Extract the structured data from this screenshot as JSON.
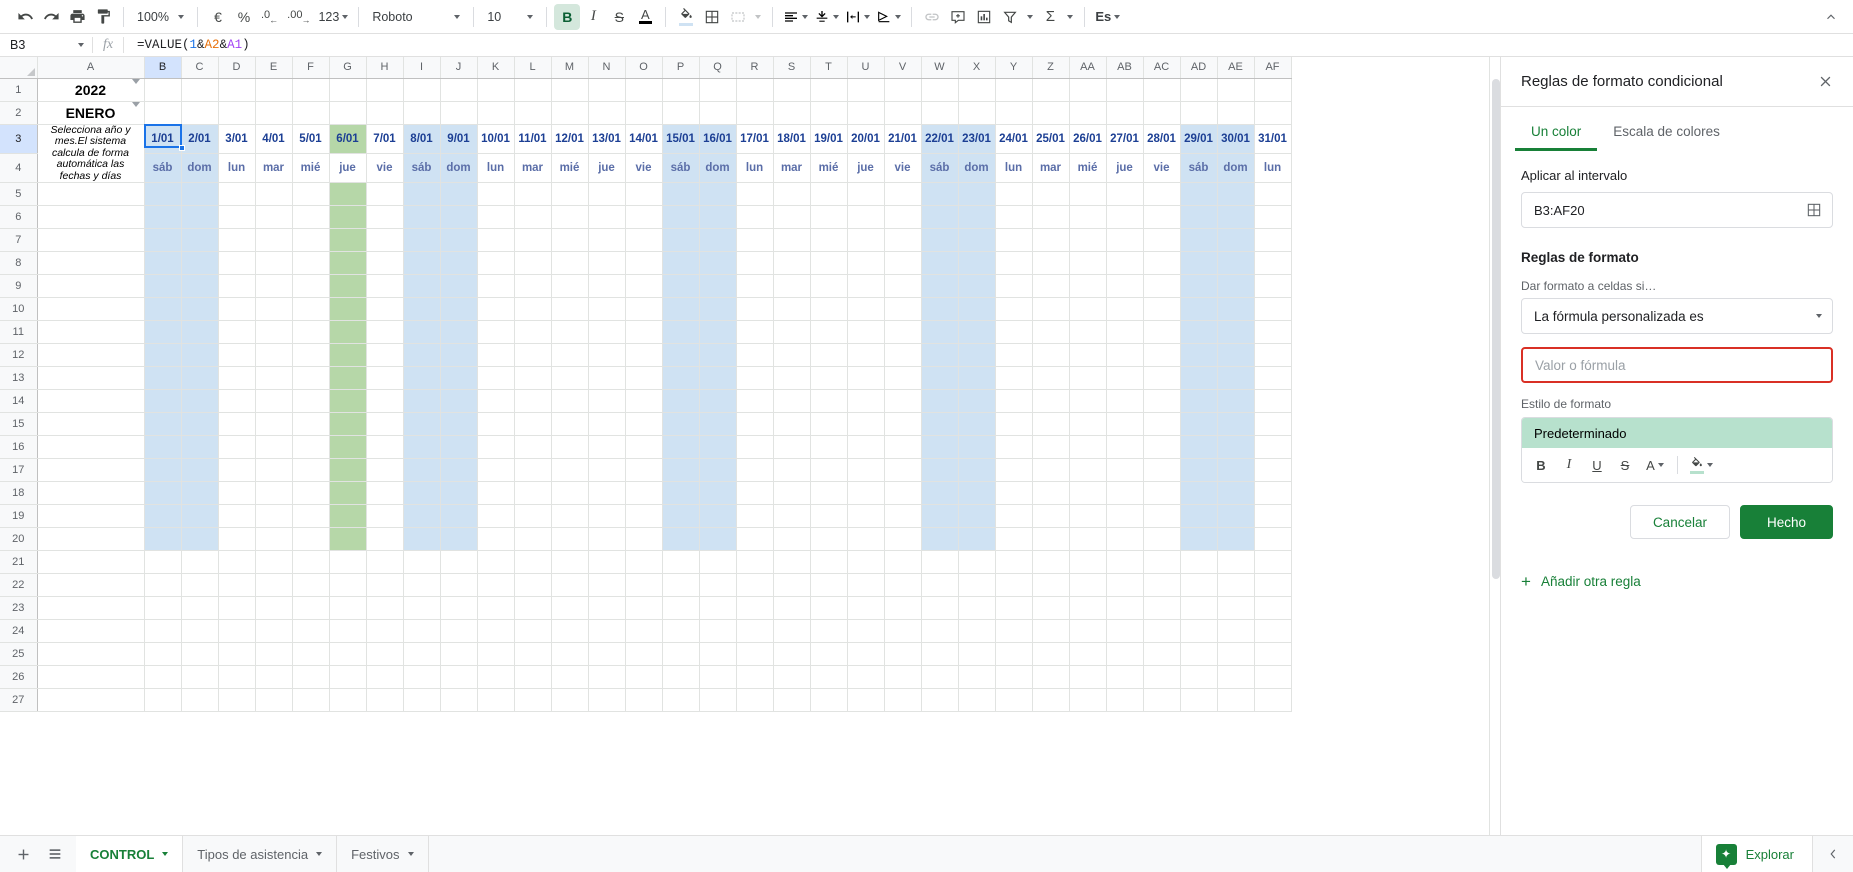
{
  "toolbar": {
    "undo_icon": "undo-icon",
    "redo_icon": "redo-icon",
    "print_icon": "print-icon",
    "paint_format_icon": "paint-format-icon",
    "zoom_value": "100%",
    "currency_label": "€",
    "percent_label": "%",
    "dec_decrease_label": ".0",
    "dec_increase_label": ".00",
    "number_format_label": "123",
    "font_family": "Roboto",
    "font_size": "10",
    "bold_label": "B",
    "italic_label": "I",
    "strikethrough_label": "S",
    "text_color_label": "A",
    "fill_color_icon": "fill-color-icon",
    "borders_icon": "borders-icon",
    "merge_icon": "merge-cells-icon",
    "halign_icon": "horizontal-align-icon",
    "valign_icon": "vertical-align-icon",
    "wrap_icon": "text-wrapping-icon",
    "rotate_icon": "text-rotation-icon",
    "link_icon": "insert-link-icon",
    "comment_icon": "insert-comment-icon",
    "chart_icon": "insert-chart-icon",
    "filter_icon": "filter-icon",
    "functions_label": "Σ",
    "lang_label": "Es",
    "collapse_label": "⌃"
  },
  "formula_bar": {
    "name_box": "B3",
    "fx_label": "fx",
    "formula_parts": [
      {
        "text": "=VALUE(",
        "class": ""
      },
      {
        "text": "1",
        "class": "tok-num"
      },
      {
        "text": "&",
        "class": ""
      },
      {
        "text": "A2",
        "class": "tok-a2"
      },
      {
        "text": "&",
        "class": ""
      },
      {
        "text": "A1",
        "class": "tok-a1"
      },
      {
        "text": ")",
        "class": ""
      }
    ],
    "formula_plain": "=VALUE(1&A2&A1)"
  },
  "sheet": {
    "column_headers": [
      "A",
      "B",
      "C",
      "D",
      "E",
      "F",
      "G",
      "H",
      "I",
      "J",
      "K",
      "L",
      "M",
      "N",
      "O",
      "P",
      "Q",
      "R",
      "S",
      "T",
      "U",
      "V",
      "W",
      "X",
      "Y",
      "Z",
      "AA",
      "AB",
      "AC",
      "AD",
      "AE",
      "AF"
    ],
    "row_headers": [
      "1",
      "2",
      "3",
      "4",
      "5",
      "6",
      "7",
      "8",
      "9",
      "10",
      "11",
      "12",
      "13",
      "14",
      "15",
      "16",
      "17",
      "18",
      "19",
      "20",
      "21",
      "22",
      "23",
      "24",
      "25",
      "26",
      "27"
    ],
    "selected_column": "B",
    "selected_row": "3",
    "a_column": {
      "year": "2022",
      "month": "ENERO",
      "note": "Selecciona año y mes.El sistema calcula de forma automática las fechas y días"
    },
    "dates": [
      "1/01",
      "2/01",
      "3/01",
      "4/01",
      "5/01",
      "6/01",
      "7/01",
      "8/01",
      "9/01",
      "10/01",
      "11/01",
      "12/01",
      "13/01",
      "14/01",
      "15/01",
      "16/01",
      "17/01",
      "18/01",
      "19/01",
      "20/01",
      "21/01",
      "22/01",
      "23/01",
      "24/01",
      "25/01",
      "26/01",
      "27/01",
      "28/01",
      "29/01",
      "30/01",
      "31/01"
    ],
    "days": [
      "sáb",
      "dom",
      "lun",
      "mar",
      "mié",
      "jue",
      "vie",
      "sáb",
      "dom",
      "lun",
      "mar",
      "mié",
      "jue",
      "vie",
      "sáb",
      "dom",
      "lun",
      "mar",
      "mié",
      "jue",
      "vie",
      "sáb",
      "dom",
      "lun",
      "mar",
      "mié",
      "jue",
      "vie",
      "sáb",
      "dom",
      "lun"
    ],
    "weekend_indices": [
      0,
      1,
      7,
      8,
      14,
      15,
      21,
      22,
      28,
      29
    ],
    "holiday_indices": [
      5
    ],
    "colors": {
      "weekend_fill": "#cfe2f3",
      "holiday_fill": "#b6d7a8",
      "date_text": "#1c3f94",
      "day_text": "#5b6ea8",
      "selection": "#1a73e8"
    }
  },
  "panel": {
    "title": "Reglas de formato condicional",
    "close_label": "✕",
    "tabs": [
      {
        "label": "Un color",
        "selected": true
      },
      {
        "label": "Escala de colores",
        "selected": false
      }
    ],
    "apply_range_label": "Aplicar al intervalo",
    "apply_range_value": "B3:AF20",
    "range_picker_icon": "select-data-range-icon",
    "format_rules_label": "Reglas de formato",
    "condition_label": "Dar formato a celdas si…",
    "condition_value": "La formula personalizada es",
    "condition_value_display": "La fórmula personalizada es",
    "formula_placeholder": "Valor o fórmula",
    "formula_value": "",
    "format_style_label": "Estilo de formato",
    "style_preview_text": "Predeterminado",
    "style_tools": {
      "bold": "B",
      "italic": "I",
      "underline": "U",
      "strikethrough": "S",
      "text_color": "A",
      "fill_color_icon": "fill-color-icon"
    },
    "cancel_label": "Cancelar",
    "done_label": "Hecho",
    "add_rule_label": "Añadir otra regla",
    "add_rule_plus": "+",
    "colors": {
      "accent_green": "#188038",
      "error_red": "#d93025",
      "style_fill": "#b7e1cd"
    }
  },
  "bottom": {
    "add_sheet_icon": "add-sheet-icon",
    "all_sheets_icon": "all-sheets-icon",
    "tabs": [
      {
        "label": "CONTROL",
        "active": true
      },
      {
        "label": "Tipos de asistencia",
        "active": false
      },
      {
        "label": "Festivos",
        "active": false
      }
    ],
    "explore_label": "Explorar",
    "explore_icon": "explore-icon",
    "collapse_icon": "chevron-left-icon"
  }
}
